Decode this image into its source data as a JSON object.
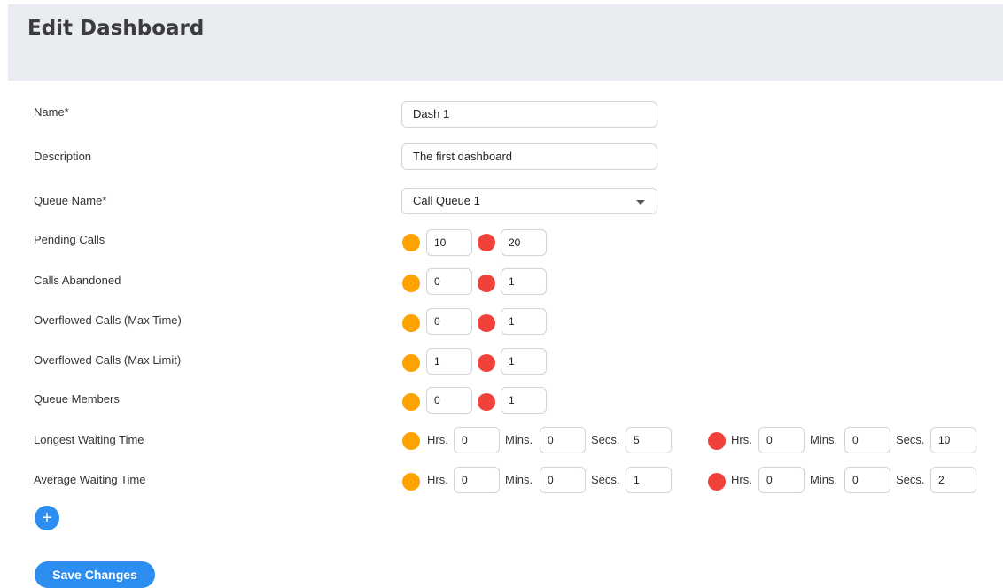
{
  "page": {
    "title": "Edit Dashboard"
  },
  "form": {
    "name": {
      "label": "Name*",
      "value": "Dash 1"
    },
    "description": {
      "label": "Description",
      "value": "The first dashboard"
    },
    "queue": {
      "label": "Queue Name*",
      "value": "Call Queue 1"
    }
  },
  "thresholds": {
    "pending_calls": {
      "label": "Pending Calls",
      "warn": "10",
      "crit": "20"
    },
    "calls_abandoned": {
      "label": "Calls Abandoned",
      "warn": "0",
      "crit": "1"
    },
    "overflow_time": {
      "label": "Overflowed Calls (Max Time)",
      "warn": "0",
      "crit": "1"
    },
    "overflow_limit": {
      "label": "Overflowed Calls (Max Limit)",
      "warn": "1",
      "crit": "1"
    },
    "queue_members": {
      "label": "Queue Members",
      "warn": "0",
      "crit": "1"
    }
  },
  "time_units": {
    "hrs": "Hrs.",
    "mins": "Mins.",
    "secs": "Secs."
  },
  "time_thresholds": {
    "longest_wait": {
      "label": "Longest Waiting Time",
      "warn": {
        "hrs": "0",
        "mins": "0",
        "secs": "5"
      },
      "crit": {
        "hrs": "0",
        "mins": "0",
        "secs": "10"
      }
    },
    "average_wait": {
      "label": "Average Waiting Time",
      "warn": {
        "hrs": "0",
        "mins": "0",
        "secs": "1"
      },
      "crit": {
        "hrs": "0",
        "mins": "0",
        "secs": "2"
      }
    }
  },
  "actions": {
    "add_symbol": "+",
    "save_label": "Save Changes"
  },
  "colors": {
    "warning": "#ffa200",
    "critical": "#f0413a",
    "accent": "#2b8ef0"
  }
}
